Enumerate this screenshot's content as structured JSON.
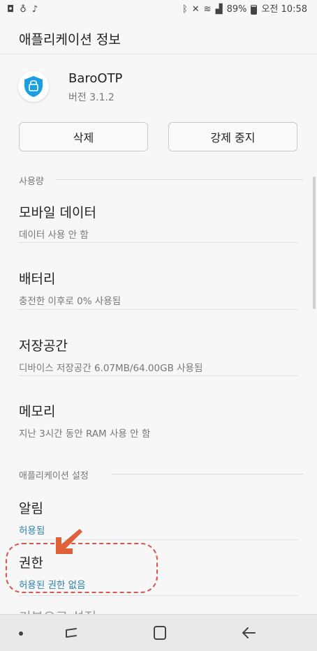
{
  "status_bar": {
    "battery": "89%",
    "time": "오전 10:58",
    "left_icons": [
      "notification-icon",
      "message-icon",
      "music-icon"
    ],
    "right_icons": [
      "bluetooth-icon",
      "mute-icon",
      "wifi-icon",
      "signal-icon",
      "battery-icon"
    ]
  },
  "app_bar": {
    "title": "애플리케이션 정보"
  },
  "app": {
    "name": "BaroOTP",
    "version": "버전 3.1.2"
  },
  "actions": {
    "uninstall": "삭제",
    "force_stop": "강제 중지"
  },
  "usage": {
    "header": "사용량",
    "items": [
      {
        "title": "모바일 데이터",
        "sub": "데이터 사용 안 함"
      },
      {
        "title": "배터리",
        "sub": "충전한 이후로 0% 사용됨"
      },
      {
        "title": "저장공간",
        "sub": "디바이스 저장공간 6.07MB/64.00GB 사용됨"
      },
      {
        "title": "메모리",
        "sub": "지난 3시간 동안 RAM 사용 안 함"
      }
    ]
  },
  "settings": {
    "header": "애플리케이션 설정",
    "items": [
      {
        "title": "알림",
        "sub": "허용됨"
      },
      {
        "title": "권한",
        "sub": "허용된 권한 없음"
      }
    ],
    "partial_title": "기본으로 설정"
  },
  "colors": {
    "accent_blue": "#2b7fb8",
    "highlight_red": "#d9534f",
    "icon_blue": "#1a9ee6"
  }
}
